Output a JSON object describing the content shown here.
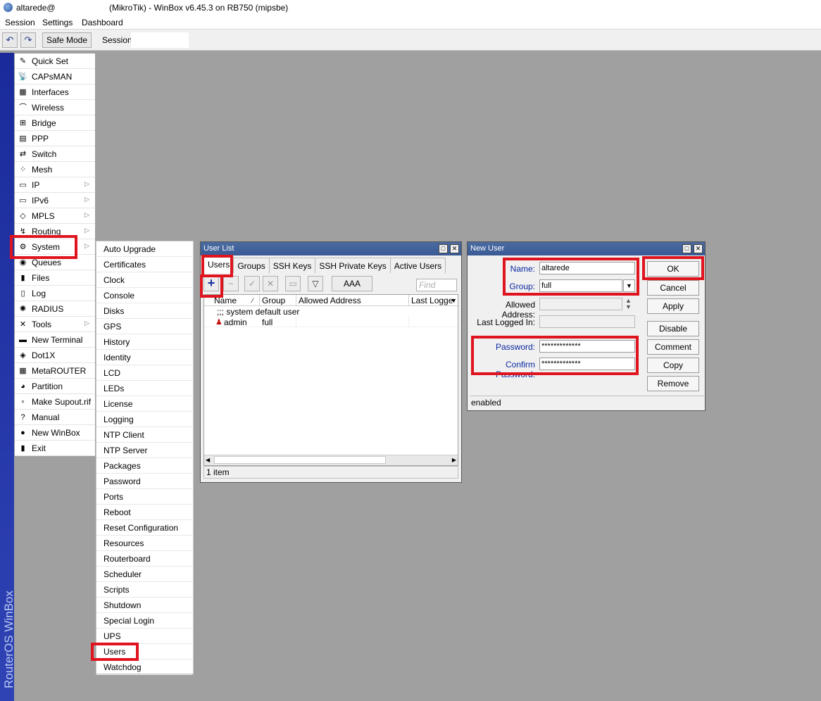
{
  "titlebar": {
    "user": "altarede@",
    "title": "(MikroTik) - WinBox v6.45.3 on RB750 (mipsbe)"
  },
  "menubar": {
    "items": [
      "Session",
      "Settings",
      "Dashboard"
    ]
  },
  "toolbar": {
    "undo_icon": "undo-icon",
    "redo_icon": "redo-icon",
    "safe_mode": "Safe Mode",
    "session_label": "Session:",
    "session_value": ""
  },
  "brand_strip": {
    "text": "RouterOS WinBox"
  },
  "main_menu": {
    "items": [
      {
        "label": "Quick Set",
        "icon": "quickset-icon",
        "glyph": "✎",
        "submenu": false
      },
      {
        "label": "CAPsMAN",
        "icon": "capsman-icon",
        "glyph": "📡",
        "submenu": false
      },
      {
        "label": "Interfaces",
        "icon": "interfaces-icon",
        "glyph": "▦",
        "submenu": false
      },
      {
        "label": "Wireless",
        "icon": "wireless-icon",
        "glyph": "⌒",
        "submenu": false
      },
      {
        "label": "Bridge",
        "icon": "bridge-icon",
        "glyph": "⊞",
        "submenu": false
      },
      {
        "label": "PPP",
        "icon": "ppp-icon",
        "glyph": "▤",
        "submenu": false
      },
      {
        "label": "Switch",
        "icon": "switch-icon",
        "glyph": "⇄",
        "submenu": false
      },
      {
        "label": "Mesh",
        "icon": "mesh-icon",
        "glyph": "⁘",
        "submenu": false
      },
      {
        "label": "IP",
        "icon": "ip-icon",
        "glyph": "▭",
        "submenu": true
      },
      {
        "label": "IPv6",
        "icon": "ipv6-icon",
        "glyph": "▭",
        "submenu": true
      },
      {
        "label": "MPLS",
        "icon": "mpls-icon",
        "glyph": "◇",
        "submenu": true
      },
      {
        "label": "Routing",
        "icon": "routing-icon",
        "glyph": "↯",
        "submenu": true
      },
      {
        "label": "System",
        "icon": "system-gear-icon",
        "glyph": "⚙",
        "submenu": true
      },
      {
        "label": "Queues",
        "icon": "queues-icon",
        "glyph": "◉",
        "submenu": false
      },
      {
        "label": "Files",
        "icon": "files-icon",
        "glyph": "▮",
        "submenu": false
      },
      {
        "label": "Log",
        "icon": "log-icon",
        "glyph": "▯",
        "submenu": false
      },
      {
        "label": "RADIUS",
        "icon": "radius-icon",
        "glyph": "✺",
        "submenu": false
      },
      {
        "label": "Tools",
        "icon": "tools-icon",
        "glyph": "✕",
        "submenu": true
      },
      {
        "label": "New Terminal",
        "icon": "terminal-icon",
        "glyph": "▬",
        "submenu": false
      },
      {
        "label": "Dot1X",
        "icon": "dot1x-icon",
        "glyph": "◈",
        "submenu": false
      },
      {
        "label": "MetaROUTER",
        "icon": "metarouter-icon",
        "glyph": "▦",
        "submenu": false
      },
      {
        "label": "Partition",
        "icon": "partition-icon",
        "glyph": "◕",
        "submenu": false
      },
      {
        "label": "Make Supout.rif",
        "icon": "supout-icon",
        "glyph": "▫",
        "submenu": false
      },
      {
        "label": "Manual",
        "icon": "manual-icon",
        "glyph": "?",
        "submenu": false
      },
      {
        "label": "New WinBox",
        "icon": "winbox-icon",
        "glyph": "●",
        "submenu": false
      },
      {
        "label": "Exit",
        "icon": "exit-icon",
        "glyph": "▮",
        "submenu": false
      }
    ]
  },
  "sub_menu": {
    "items": [
      "Auto Upgrade",
      "Certificates",
      "Clock",
      "Console",
      "Disks",
      "GPS",
      "History",
      "Identity",
      "LCD",
      "LEDs",
      "License",
      "Logging",
      "NTP Client",
      "NTP Server",
      "Packages",
      "Password",
      "Ports",
      "Reboot",
      "Reset Configuration",
      "Resources",
      "Routerboard",
      "Scheduler",
      "Scripts",
      "Shutdown",
      "Special Login",
      "UPS",
      "Users",
      "Watchdog"
    ]
  },
  "user_list": {
    "title": "User List",
    "tabs": [
      "Users",
      "Groups",
      "SSH Keys",
      "SSH Private Keys",
      "Active Users"
    ],
    "aaa_label": "AAA",
    "find_placeholder": "Find",
    "columns": [
      "Name",
      "Group",
      "Allowed Address",
      "Last Logge"
    ],
    "comment_row": ";;; system default user",
    "rows": [
      {
        "name": "admin",
        "group": "full",
        "allowed": "",
        "last": ""
      }
    ],
    "status": "1 item"
  },
  "new_user": {
    "title": "New User",
    "name_label": "Name:",
    "name_value": "altarede",
    "group_label": "Group:",
    "group_value": "full",
    "allowed_label": "Allowed Address:",
    "allowed_value": "",
    "last_label": "Last Logged In:",
    "last_value": "",
    "password_label": "Password:",
    "password_value": "*************",
    "confirm_label": "Confirm Password:",
    "confirm_value": "*************",
    "buttons": [
      "OK",
      "Cancel",
      "Apply",
      "Disable",
      "Comment",
      "Copy",
      "Remove"
    ],
    "status": "enabled"
  },
  "colors": {
    "highlight": "#e0141e",
    "window_title": "#3a5a96",
    "desktop": "#a0a0a0",
    "brand_strip": "#1a2a9a"
  }
}
